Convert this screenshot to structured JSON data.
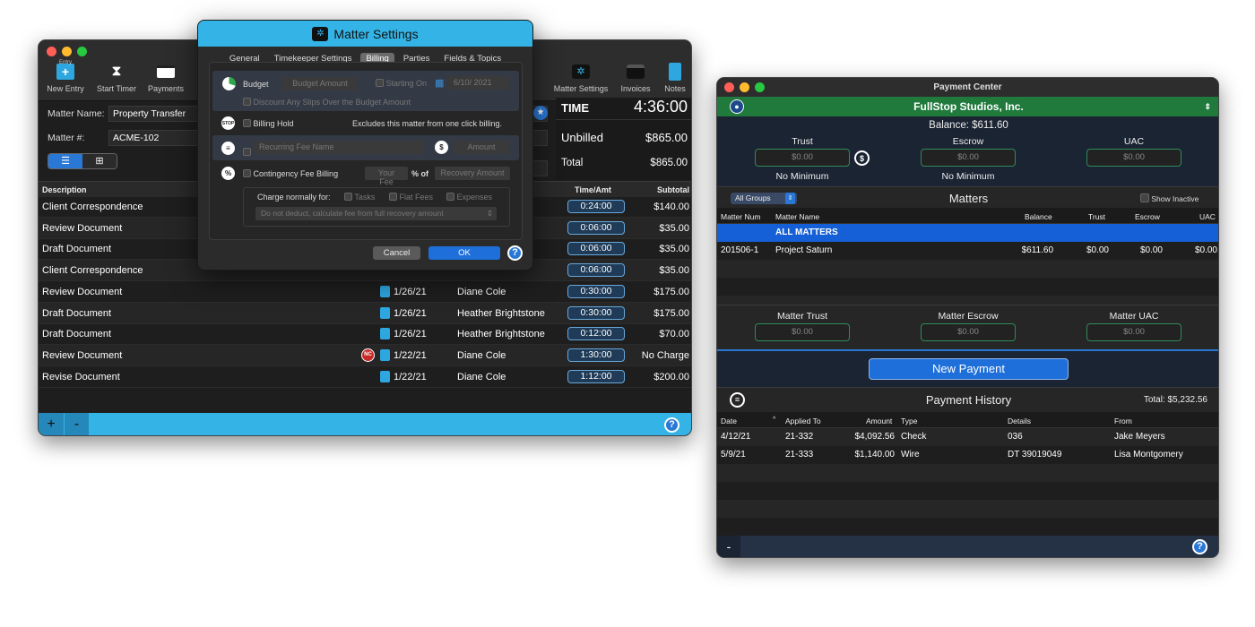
{
  "main": {
    "toolbar": {
      "entry_label": "Entry",
      "new_entry": "New Entry",
      "start_timer": "Start Timer",
      "payments": "Payments",
      "matter_settings": "Matter Settings",
      "invoices": "Invoices",
      "notes": "Notes"
    },
    "matter_name_label": "Matter Name:",
    "matter_name_value": "Property Transfer",
    "matter_num_label": "Matter #:",
    "matter_num_value": "ACME-102",
    "time_label": "TIME",
    "time_value": "4:36:00",
    "unbilled_label": "Unbilled",
    "unbilled_value": "$865.00",
    "total_label": "Total",
    "total_value": "$865.00",
    "columns": {
      "description": "Description",
      "time_amt": "Time/Amt",
      "subtotal": "Subtotal"
    },
    "rows": [
      {
        "desc": "Client Correspondence",
        "date": "",
        "person": "",
        "time": "0:24:00",
        "subtotal": "$140.00"
      },
      {
        "desc": "Review Document",
        "date": "",
        "person": "",
        "time": "0:06:00",
        "subtotal": "$35.00"
      },
      {
        "desc": "Draft Document",
        "date": "",
        "person": "",
        "time": "0:06:00",
        "subtotal": "$35.00"
      },
      {
        "desc": "Client Correspondence",
        "date": "",
        "person": "",
        "time": "0:06:00",
        "subtotal": "$35.00"
      },
      {
        "desc": "Review Document",
        "date": "1/26/21",
        "person": "Diane Cole",
        "time": "0:30:00",
        "subtotal": "$175.00"
      },
      {
        "desc": "Draft Document",
        "date": "1/26/21",
        "person": "Heather Brightstone",
        "time": "0:30:00",
        "subtotal": "$175.00"
      },
      {
        "desc": "Draft Document",
        "date": "1/26/21",
        "person": "Heather Brightstone",
        "time": "0:12:00",
        "subtotal": "$70.00"
      },
      {
        "desc": "Review Document",
        "date": "1/22/21",
        "person": "Diane Cole",
        "time": "1:30:00",
        "subtotal": "No Charge",
        "badge": "NC"
      },
      {
        "desc": "Revise Document",
        "date": "1/22/21",
        "person": "Diane Cole",
        "time": "1:12:00",
        "subtotal": "$200.00"
      }
    ],
    "add": "+",
    "remove": "-",
    "help": "?"
  },
  "dialog": {
    "title": "Matter Settings",
    "tabs": [
      "General",
      "Timekeeper Settings",
      "Billing",
      "Parties",
      "Fields & Topics"
    ],
    "budget": "Budget",
    "budget_amount_ph": "Budget Amount",
    "starting_on": "Starting On",
    "start_date": "6/10/ 2021",
    "discount": "Discount Any Slips Over the Budget Amount",
    "stop": "STOP",
    "billing_hold": "Billing Hold",
    "billing_hold_desc": "Excludes this matter from one click billing.",
    "recurring_ph": "Recurring Fee Name",
    "amount_ph": "Amount",
    "contingency": "Contingency Fee Billing",
    "your_fee_ph": "Your Fee",
    "pct_of": "% of",
    "recovery_ph": "Recovery Amount",
    "charge_normally": "Charge normally for:",
    "tasks": "Tasks",
    "flat_fees": "Flat Fees",
    "expenses": "Expenses",
    "deduct_select": "Do not deduct, calculate fee from full recovery amount",
    "cancel": "Cancel",
    "ok": "OK",
    "help": "?"
  },
  "payment": {
    "title": "Payment Center",
    "client": "FullStop Studios, Inc.",
    "balance": "Balance: $611.60",
    "trust": "Trust",
    "escrow": "Escrow",
    "uac": "UAC",
    "trust_val": "$0.00",
    "escrow_val": "$0.00",
    "uac_val": "$0.00",
    "no_min": "No Minimum",
    "groups": "All Groups",
    "matters": "Matters",
    "show_inactive": "Show Inactive",
    "cols": {
      "num": "Matter Num",
      "name": "Matter Name",
      "balance": "Balance",
      "trust": "Trust",
      "escrow": "Escrow",
      "uac": "UAC"
    },
    "all_matters": "ALL MATTERS",
    "matter_rows": [
      {
        "num": "201506-1",
        "name": "Project Saturn",
        "balance": "$611.60",
        "trust": "$0.00",
        "escrow": "$0.00",
        "uac": "$0.00"
      }
    ],
    "matter_trust": "Matter Trust",
    "matter_escrow": "Matter Escrow",
    "matter_uac": "Matter UAC",
    "mt_val": "$0.00",
    "me_val": "$0.00",
    "mu_val": "$0.00",
    "new_payment": "New Payment",
    "history": "Payment History",
    "history_total": "Total: $5,232.56",
    "hcols": {
      "date": "Date",
      "applied": "Applied To",
      "amount": "Amount",
      "type": "Type",
      "details": "Details",
      "from": "From"
    },
    "history_rows": [
      {
        "date": "4/12/21",
        "applied": "21-332",
        "amount": "$4,092.56",
        "type": "Check",
        "details": "036",
        "from": "Jake Meyers"
      },
      {
        "date": "5/9/21",
        "applied": "21-333",
        "amount": "$1,140.00",
        "type": "Wire",
        "details": "DT 39019049",
        "from": "Lisa Montgomery"
      }
    ],
    "remove": "-",
    "help": "?"
  }
}
